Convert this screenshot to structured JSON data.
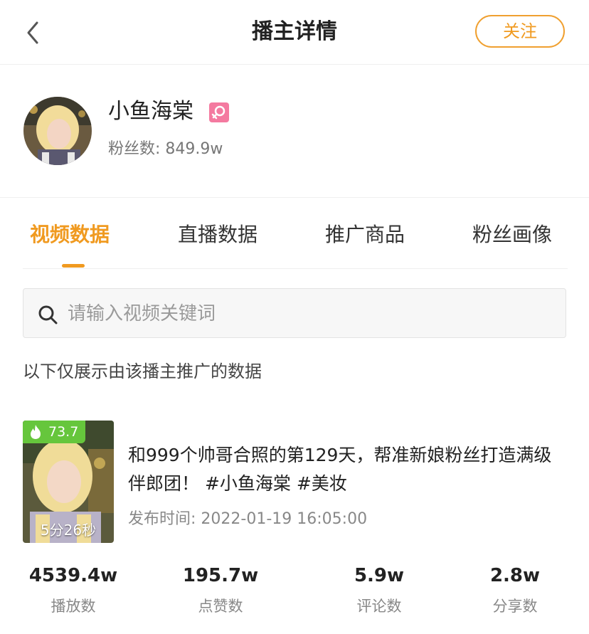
{
  "header": {
    "title": "播主详情",
    "follow_label": "关注",
    "back_icon": "chevron-left-icon"
  },
  "profile": {
    "name": "小鱼海棠",
    "gender_icon": "female-icon",
    "fans_label": "粉丝数: ",
    "fans_value": "849.9w"
  },
  "tabs": [
    {
      "label": "视频数据",
      "active": true
    },
    {
      "label": "直播数据",
      "active": false
    },
    {
      "label": "推广商品",
      "active": false
    },
    {
      "label": "粉丝画像",
      "active": false
    }
  ],
  "search": {
    "placeholder": "请输入视频关键词",
    "value": ""
  },
  "note": "以下仅展示由该播主推广的数据",
  "video": {
    "score": "73.7",
    "duration": "5分26秒",
    "title": "和999个帅哥合照的第129天，帮准新娘粉丝打造满级伴郎团！ #小鱼海棠 #美妆",
    "date_label": "发布时间: ",
    "date_value": "2022-01-19 16:05:00"
  },
  "stats": [
    {
      "value": "4539.4w",
      "label": "播放数"
    },
    {
      "value": "195.7w",
      "label": "点赞数"
    },
    {
      "value": "5.9w",
      "label": "评论数"
    },
    {
      "value": "2.8w",
      "label": "分享数"
    }
  ],
  "colors": {
    "accent": "#f09a20",
    "score_bg": "#66c63c",
    "gender_bg": "#f47aa0"
  }
}
